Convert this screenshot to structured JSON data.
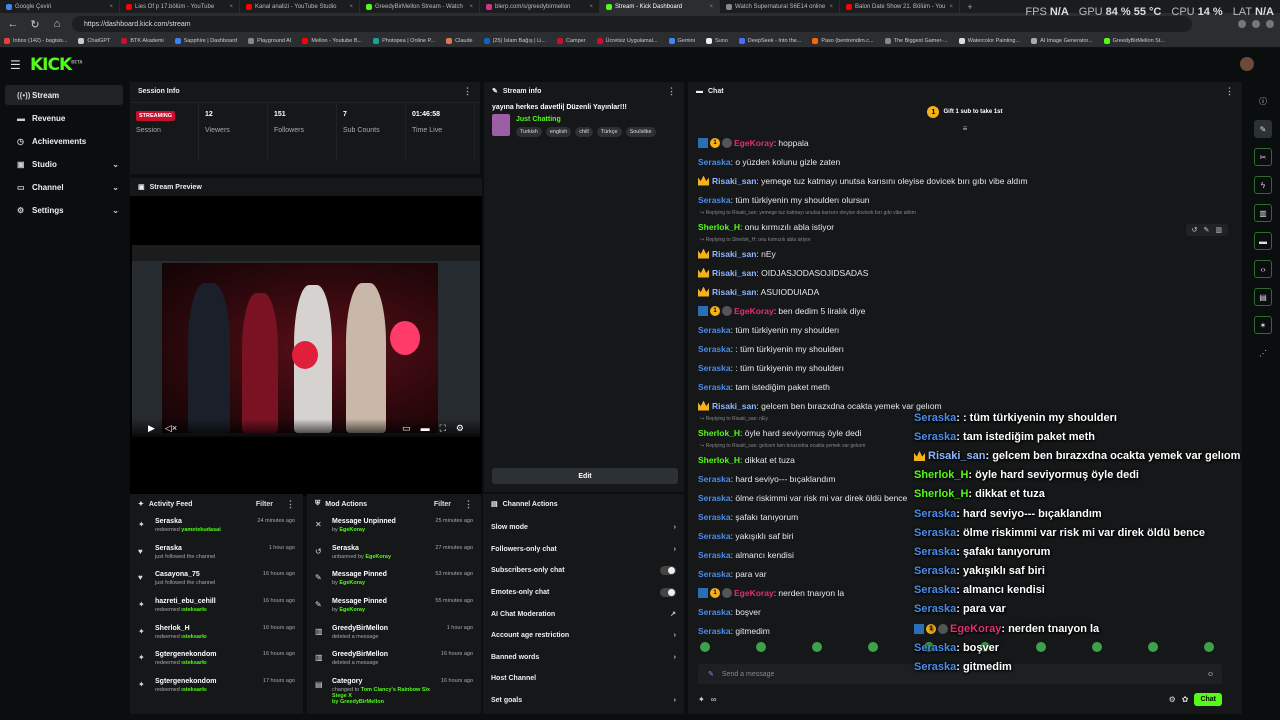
{
  "browser": {
    "tabs": [
      {
        "title": "Google Çeviri",
        "color": "#4285f4",
        "active": false
      },
      {
        "title": "Lies Of p 17.bölüm - YouTube",
        "color": "#ff0000",
        "active": false
      },
      {
        "title": "Kanal analizi - YouTube Studio",
        "color": "#ff0000",
        "active": false
      },
      {
        "title": "GreedyBirMellon Stream - Watch",
        "color": "#53fc18",
        "active": false
      },
      {
        "title": "blerp.com/s/greedybirmellon",
        "color": "#d63384",
        "active": false
      },
      {
        "title": "Stream - Kick Dashboard",
        "color": "#53fc18",
        "active": true
      },
      {
        "title": "Watch Supernatural S6E14 online",
        "color": "#888888",
        "active": false
      },
      {
        "title": "Balon Date Show 21. Bölüm - You",
        "color": "#ff0000",
        "active": false
      }
    ],
    "url": "https://dashboard.kick.com/stream",
    "bookmarks": [
      {
        "label": "Inbox (142) - bagisis...",
        "color": "#ea4335"
      },
      {
        "label": "ChatGPT",
        "color": "#cccccc"
      },
      {
        "label": "BTK Akademi",
        "color": "#c8102e"
      },
      {
        "label": "Sapphire | Dashboard",
        "color": "#3b82f6"
      },
      {
        "label": "Playground AI",
        "color": "#888888"
      },
      {
        "label": "Mellon - Youtube B...",
        "color": "#ff0000"
      },
      {
        "label": "Photopea | Online P...",
        "color": "#18a497"
      },
      {
        "label": "Claude",
        "color": "#d97757"
      },
      {
        "label": "(25) İslam Bağış | Li...",
        "color": "#0a66c2"
      },
      {
        "label": "Camper",
        "color": "#c8102e"
      },
      {
        "label": "Ücretsiz Uygulamal...",
        "color": "#c8102e"
      },
      {
        "label": "Gemini",
        "color": "#4285f4"
      },
      {
        "label": "Suno",
        "color": "#eeeeee"
      },
      {
        "label": "DeepSeek - Into the...",
        "color": "#4d6bfe"
      },
      {
        "label": "Paso (bentrendim.c...",
        "color": "#ff6600"
      },
      {
        "label": "The Biggest Gamer-...",
        "color": "#888888"
      },
      {
        "label": "Watercolor Painting...",
        "color": "#dddddd"
      },
      {
        "label": "AI Image Generator...",
        "color": "#aaaaaa"
      },
      {
        "label": "GreedyBirMellon St...",
        "color": "#53fc18"
      }
    ]
  },
  "hud": {
    "fps_label": "FPS",
    "fps_value": "N/A",
    "gpu_label": "GPU",
    "gpu_value": "84 % 55 °C",
    "cpu_label": "CPU",
    "cpu_value": "14 %",
    "lat_label": "LAT",
    "lat_value": "N/A"
  },
  "brand": {
    "logo": "KICK",
    "logo_sup": "BETA",
    "accent": "#53fc18"
  },
  "sidebar": {
    "items": [
      {
        "label": "Stream",
        "icon": "broadcast-icon",
        "glyph": "((•))",
        "active": true,
        "chevron": false
      },
      {
        "label": "Revenue",
        "icon": "revenue-icon",
        "glyph": "▬",
        "active": false,
        "chevron": false
      },
      {
        "label": "Achievements",
        "icon": "trophy-icon",
        "glyph": "◷",
        "active": false,
        "chevron": false
      },
      {
        "label": "Studio",
        "icon": "studio-icon",
        "glyph": "▣",
        "active": false,
        "chevron": true
      },
      {
        "label": "Channel",
        "icon": "channel-icon",
        "glyph": "▭",
        "active": false,
        "chevron": true
      },
      {
        "label": "Settings",
        "icon": "settings-icon",
        "glyph": "⚙",
        "active": false,
        "chevron": true
      }
    ]
  },
  "session": {
    "title": "Session Info",
    "status_badge": "STREAMING",
    "cells": [
      {
        "value": "",
        "label": "Session"
      },
      {
        "value": "12",
        "label": "Viewers"
      },
      {
        "value": "151",
        "label": "Followers"
      },
      {
        "value": "7",
        "label": "Sub Counts"
      },
      {
        "value": "01:46:58",
        "label": "Time Live"
      }
    ]
  },
  "preview": {
    "title": "Stream Preview"
  },
  "stream_info": {
    "title": "Stream info",
    "stream_title": "yayına herkes davetli| Düzenli Yayınlar!!!",
    "category": "Just Chatting",
    "tags": [
      "Turkish",
      "english",
      "chill",
      "Türkçe",
      "Soulslike"
    ],
    "edit_label": "Edit"
  },
  "activity": {
    "title": "Activity Feed",
    "filter_label": "Filter",
    "items": [
      {
        "icon": "gift-icon",
        "glyph": "✦",
        "name": "Seraska",
        "pre": "redeemed ",
        "hl": "yametekudasai",
        "time": "24 minutes ago"
      },
      {
        "icon": "heart-icon",
        "glyph": "♥",
        "name": "Seraska",
        "pre": "just followed the channel",
        "hl": "",
        "time": "1 hour ago"
      },
      {
        "icon": "heart-icon",
        "glyph": "♥",
        "name": "Casayona_75",
        "pre": "just followed the channel",
        "hl": "",
        "time": "16 hours ago"
      },
      {
        "icon": "gift-icon",
        "glyph": "✦",
        "name": "hazreti_ebu_cehill",
        "pre": "redeemed ",
        "hl": "ısteksarkı",
        "time": "16 hours ago"
      },
      {
        "icon": "gift-icon",
        "glyph": "✦",
        "name": "Sherlok_H",
        "pre": "redeemed ",
        "hl": "ısteksarkı",
        "time": "16 hours ago"
      },
      {
        "icon": "gift-icon",
        "glyph": "✦",
        "name": "Sgtergenekondom",
        "pre": "redeemed ",
        "hl": "ısteksarkı",
        "time": "16 hours ago"
      },
      {
        "icon": "gift-icon",
        "glyph": "✦",
        "name": "Sgtergenekondom",
        "pre": "redeemed ",
        "hl": "ısteksarkı",
        "time": "17 hours ago"
      }
    ]
  },
  "mod_actions": {
    "title": "Mod Actions",
    "filter_label": "Filter",
    "items": [
      {
        "icon": "unpin-icon",
        "glyph": "✕",
        "name": "Message Unpinned",
        "pre": "by ",
        "hl": "EgeKoray",
        "time": "25 minutes ago"
      },
      {
        "icon": "unban-icon",
        "glyph": "↺",
        "name": "Seraska",
        "pre": "unbanned by ",
        "hl": "EgeKoray",
        "time": "27 minutes ago"
      },
      {
        "icon": "pin-icon",
        "glyph": "✎",
        "name": "Message Pinned",
        "pre": "by ",
        "hl": "EgeKoray",
        "time": "53 minutes ago"
      },
      {
        "icon": "pin-icon",
        "glyph": "✎",
        "name": "Message Pinned",
        "pre": "by ",
        "hl": "EgeKoray",
        "time": "55 minutes ago"
      },
      {
        "icon": "trash-icon",
        "glyph": "▥",
        "name": "GreedyBirMellon",
        "pre": "deleted a message",
        "hl": "",
        "time": "1 hour ago"
      },
      {
        "icon": "trash-icon",
        "glyph": "▥",
        "name": "GreedyBirMellon",
        "pre": "deleted a message",
        "hl": "",
        "time": "16 hours ago"
      },
      {
        "icon": "category-icon",
        "glyph": "▤",
        "name": "Category",
        "pre": "changed to ",
        "hl": "Tom Clancy's Rainbow Six Siege X",
        "hl2": "by GreedyBirMellon",
        "time": "16 hours ago"
      }
    ]
  },
  "channel_actions": {
    "title": "Channel Actions",
    "items": [
      {
        "label": "Slow mode",
        "control": "arrow"
      },
      {
        "label": "Followers-only chat",
        "control": "arrow"
      },
      {
        "label": "Subscribers-only chat",
        "control": "toggle"
      },
      {
        "label": "Emotes-only chat",
        "control": "toggle"
      },
      {
        "label": "AI Chat Moderation",
        "control": "link"
      },
      {
        "label": "Account age restriction",
        "control": "arrow"
      },
      {
        "label": "Banned words",
        "control": "arrow"
      },
      {
        "label": "Host Channel",
        "control": "none"
      },
      {
        "label": "Set goals",
        "control": "arrow"
      }
    ]
  },
  "chat": {
    "title": "Chat",
    "gift_text": "Gift 1 sub to take 1st",
    "gift_coin": "1",
    "input_placeholder": "Send a message",
    "send_label": "Chat",
    "infinity": "∞",
    "colors": {
      "blue": "#4a8ce8",
      "green": "#53fc18",
      "pink": "#e0326e",
      "yellow": "#f3b21b",
      "light": "#8fb6ff"
    },
    "messages": [
      {
        "kind": "msg",
        "badges": [
          "mod",
          "coin",
          "gray"
        ],
        "user": "EgeKoray",
        "color": "#e0326e",
        "text": ": hoppala"
      },
      {
        "kind": "msg",
        "badges": [],
        "user": "Seraska",
        "color": "#4a8ce8",
        "text": ": o yüzden kolunu gizle zaten"
      },
      {
        "kind": "msg",
        "badges": [
          "crown"
        ],
        "user": "Risaki_san",
        "color": "#8fb6ff",
        "text": ": yemege tuz katmayı unutsa karısını oleyise dovicek bırı gıbı vibe aldım"
      },
      {
        "kind": "msg",
        "badges": [],
        "user": "Seraska",
        "color": "#4a8ce8",
        "text": ": tüm türkiyenin my shoulderı olursun"
      },
      {
        "kind": "reply",
        "text": "↪ Replying to Risaki_san: yemege tuz katmayı unutsa karısını oleyise dovicek bırı gıbı vibe aldım"
      },
      {
        "kind": "msg",
        "badges": [],
        "user": "Sherlok_H",
        "color": "#53fc18",
        "text": ": onu kırmızılı abla istiyor"
      },
      {
        "kind": "reply",
        "text": "↪ Replying to Sherlok_H: onu kırmızılı abla istiyor"
      },
      {
        "kind": "msg",
        "badges": [
          "crown"
        ],
        "user": "Risaki_san",
        "color": "#8fb6ff",
        "text": ": nEy"
      },
      {
        "kind": "msg",
        "badges": [
          "crown"
        ],
        "user": "Risaki_san",
        "color": "#8fb6ff",
        "text": ": OIDJASJODASOJIDSADAS"
      },
      {
        "kind": "msg",
        "badges": [
          "crown"
        ],
        "user": "Risaki_san",
        "color": "#8fb6ff",
        "text": ": ASUIODUIADA"
      },
      {
        "kind": "msg",
        "badges": [
          "mod",
          "coin",
          "gray"
        ],
        "user": "EgeKoray",
        "color": "#e0326e",
        "text": ": ben dedim 5 liralık diye"
      },
      {
        "kind": "msg",
        "badges": [],
        "user": "Seraska",
        "color": "#4a8ce8",
        "text": ": tüm türkiyenin my shoulderı"
      },
      {
        "kind": "msg",
        "badges": [],
        "user": "Seraska",
        "color": "#4a8ce8",
        "text": ": : tüm türkiyenin my shoulderı"
      },
      {
        "kind": "msg",
        "badges": [],
        "user": "Seraska",
        "color": "#4a8ce8",
        "text": ": : tüm türkiyenin my shoulderı"
      },
      {
        "kind": "msg",
        "badges": [],
        "user": "Seraska",
        "color": "#4a8ce8",
        "text": ": tam istediğim paket meth"
      },
      {
        "kind": "msg",
        "badges": [
          "crown"
        ],
        "user": "Risaki_san",
        "color": "#8fb6ff",
        "text": ": gelcem ben bırazxdna ocakta yemek var gelıom"
      },
      {
        "kind": "reply",
        "text": "↪ Replying to Risaki_san: nEy"
      },
      {
        "kind": "msg",
        "badges": [],
        "user": "Sherlok_H",
        "color": "#53fc18",
        "text": ": öyle hard seviyormuş öyle dedi"
      },
      {
        "kind": "reply",
        "text": "↪ Replying to Risaki_san: gelcem ben bırazxdna ocakta yemek var gelıom"
      },
      {
        "kind": "msg",
        "badges": [],
        "user": "Sherlok_H",
        "color": "#53fc18",
        "text": ": dikkat et tuza"
      },
      {
        "kind": "msg",
        "badges": [],
        "user": "Seraska",
        "color": "#4a8ce8",
        "text": ": hard seviyo--- bıçaklandım"
      },
      {
        "kind": "msg",
        "badges": [],
        "user": "Seraska",
        "color": "#4a8ce8",
        "text": ": ölme riskimmi var risk mi var direk öldü bence"
      },
      {
        "kind": "msg",
        "badges": [],
        "user": "Seraska",
        "color": "#4a8ce8",
        "text": ": şafakı tanıyorum"
      },
      {
        "kind": "msg",
        "badges": [],
        "user": "Seraska",
        "color": "#4a8ce8",
        "text": ": yakışıklı saf biri"
      },
      {
        "kind": "msg",
        "badges": [],
        "user": "Seraska",
        "color": "#4a8ce8",
        "text": ": almancı kendisi"
      },
      {
        "kind": "msg",
        "badges": [],
        "user": "Seraska",
        "color": "#4a8ce8",
        "text": ": para var"
      },
      {
        "kind": "msg",
        "badges": [
          "mod",
          "coin",
          "gray"
        ],
        "user": "EgeKoray",
        "color": "#e0326e",
        "text": ": nerden tnaıyon la"
      },
      {
        "kind": "msg",
        "badges": [],
        "user": "Seraska",
        "color": "#4a8ce8",
        "text": ": boşver"
      },
      {
        "kind": "msg",
        "badges": [],
        "user": "Seraska",
        "color": "#4a8ce8",
        "text": ": gitmedim"
      }
    ]
  },
  "overlay": {
    "lines": [
      {
        "badges": [],
        "user": "Seraska",
        "color": "#4a8ce8",
        "text": ": : tüm türkiyenin my shoulderı"
      },
      {
        "badges": [],
        "user": "Seraska",
        "color": "#4a8ce8",
        "text": ": tam istediğim paket meth"
      },
      {
        "badges": [
          "crown"
        ],
        "user": "Risaki_san",
        "color": "#8fb6ff",
        "text": ": gelcem ben bırazxdna ocakta yemek var gelıom"
      },
      {
        "badges": [],
        "user": "Sherlok_H",
        "color": "#53fc18",
        "text": ": öyle hard seviyormuş öyle dedi"
      },
      {
        "badges": [],
        "user": "Sherlok_H",
        "color": "#53fc18",
        "text": ": dikkat et tuza"
      },
      {
        "badges": [],
        "user": "Seraska",
        "color": "#4a8ce8",
        "text": ": hard seviyo--- bıçaklandım"
      },
      {
        "badges": [],
        "user": "Seraska",
        "color": "#4a8ce8",
        "text": ": ölme riskimmi var risk mi var direk öldü bence"
      },
      {
        "badges": [],
        "user": "Seraska",
        "color": "#4a8ce8",
        "text": ": şafakı tanıyorum"
      },
      {
        "badges": [],
        "user": "Seraska",
        "color": "#4a8ce8",
        "text": ": yakışıklı saf biri"
      },
      {
        "badges": [],
        "user": "Seraska",
        "color": "#4a8ce8",
        "text": ": almancı kendisi"
      },
      {
        "badges": [],
        "user": "Seraska",
        "color": "#4a8ce8",
        "text": ": para var"
      },
      {
        "badges": [
          "mod",
          "coin",
          "gray"
        ],
        "user": "EgeKoray",
        "color": "#e0326e",
        "text": ": nerden tnaıyon la"
      },
      {
        "badges": [],
        "user": "Seraska",
        "color": "#4a8ce8",
        "text": ": boşver"
      },
      {
        "badges": [],
        "user": "Seraska",
        "color": "#4a8ce8",
        "text": ": gitmedim"
      }
    ]
  },
  "right_tools": [
    {
      "icon": "info-icon",
      "glyph": "ⓘ",
      "style": ""
    },
    {
      "icon": "edit-icon",
      "glyph": "✎",
      "style": "sel"
    },
    {
      "icon": "clip-icon",
      "glyph": "✂",
      "style": "g"
    },
    {
      "icon": "bolt-icon",
      "glyph": "ϟ",
      "style": "g"
    },
    {
      "icon": "trash-tool-icon",
      "glyph": "▥",
      "style": "g"
    },
    {
      "icon": "chat-bubble-icon",
      "glyph": "▬",
      "style": "g"
    },
    {
      "icon": "code-icon",
      "glyph": "‹›",
      "style": "g"
    },
    {
      "icon": "calendar-icon",
      "glyph": "▤",
      "style": "g"
    },
    {
      "icon": "wrench-icon",
      "glyph": "✶",
      "style": "g"
    },
    {
      "icon": "share-icon",
      "glyph": "⋰",
      "style": ""
    }
  ]
}
